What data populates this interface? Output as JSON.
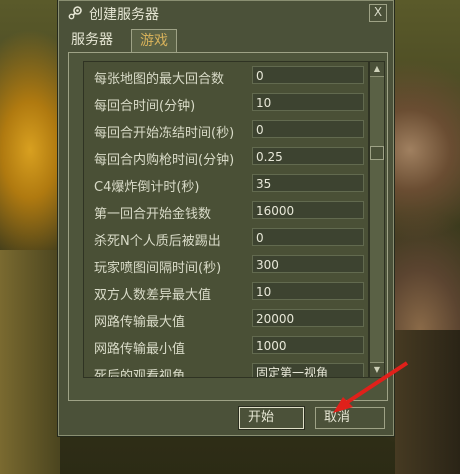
{
  "window": {
    "title": "创建服务器",
    "close_glyph": "X"
  },
  "tabs": [
    {
      "label": "服务器",
      "active": false
    },
    {
      "label": "游戏",
      "active": true
    }
  ],
  "settings": [
    {
      "label": "每张地图的最大回合数",
      "value": "0"
    },
    {
      "label": "每回合时间(分钟)",
      "value": "10"
    },
    {
      "label": "每回合开始冻结时间(秒)",
      "value": "0"
    },
    {
      "label": "每回合内购枪时间(分钟)",
      "value": "0.25"
    },
    {
      "label": "C4爆炸倒计时(秒)",
      "value": "35"
    },
    {
      "label": "第一回合开始金钱数",
      "value": "16000"
    },
    {
      "label": "杀死N个人质后被踢出",
      "value": "0"
    },
    {
      "label": "玩家喷图间隔时间(秒)",
      "value": "300"
    },
    {
      "label": "双方人数差异最大值",
      "value": "10"
    },
    {
      "label": "网路传输最大值",
      "value": "20000"
    },
    {
      "label": "网路传输最小值",
      "value": "1000"
    },
    {
      "label": "死后的观看视角",
      "value": "固定第一视角"
    }
  ],
  "buttons": {
    "start": "开始",
    "cancel": "取消"
  },
  "colors": {
    "accent_tab": "#d6b15a",
    "annotation_arrow": "#e0201a"
  }
}
